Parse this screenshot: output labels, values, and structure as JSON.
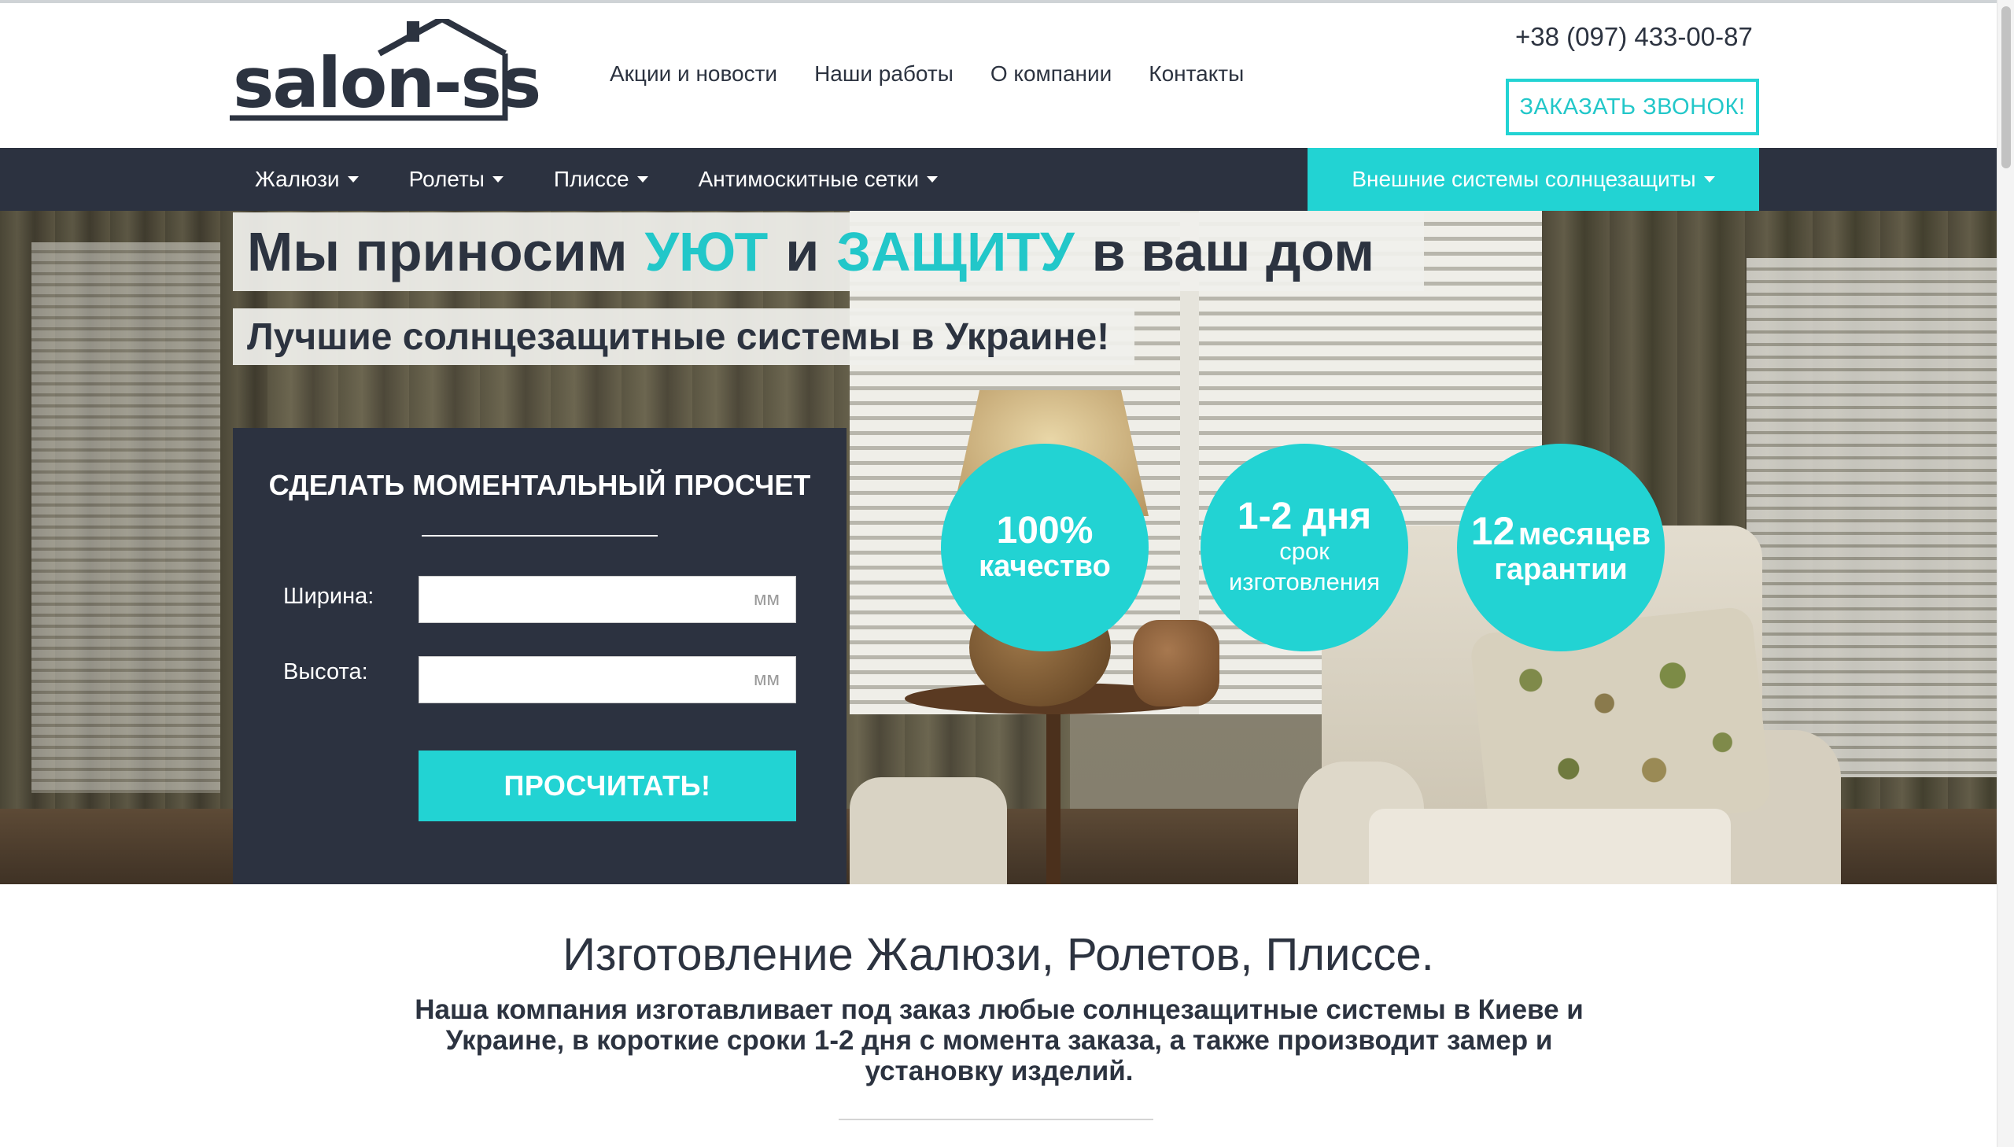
{
  "header": {
    "logo_text": "salon-ss",
    "nav": [
      "Акции и новости",
      "Наши работы",
      "О компании",
      "Контакты"
    ],
    "phone": "+38 (097) 433-00-87",
    "callback_label": "ЗАКАЗАТЬ ЗВОНОК!"
  },
  "menu": {
    "items": [
      "Жалюзи",
      "Ролеты",
      "Плиссе",
      "Антимоскитные сетки"
    ],
    "accent_item": "Внешние системы солнцезащиты"
  },
  "hero": {
    "headline_part1": "Мы приносим",
    "headline_accent1": "УЮТ",
    "headline_and": "и",
    "headline_accent2": "ЗАЩИТУ",
    "headline_part2": "в ваш дом",
    "subheadline": "Лучшие солнцезащитные системы в Украине!"
  },
  "calculator": {
    "title": "СДЕЛАТЬ МОМЕНТАЛЬНЫЙ ПРОСЧЕТ",
    "width_label": "Ширина:",
    "width_placeholder": "мм",
    "height_label": "Высота:",
    "height_placeholder": "мм",
    "submit_label": "ПРОСЧИТАТЬ!"
  },
  "badges": [
    {
      "big": "100%",
      "small": "качество"
    },
    {
      "big": "1-2 дня",
      "line1": "срок",
      "line2": "изготовления"
    },
    {
      "num": "12",
      "word": "месяцев",
      "line2": "гарантии"
    }
  ],
  "content": {
    "title": "Изготовление Жалюзи, Ролетов, Плиссе.",
    "text": "Наша компания изготавливает под заказ любые солнцезащитные системы в Киеве и Украине, в короткие сроки 1-2 дня с момента заказа, а также производит замер и установку изделий."
  },
  "colors": {
    "accent": "#22d3d3",
    "dark": "#2c3240",
    "text": "#2c3340"
  }
}
